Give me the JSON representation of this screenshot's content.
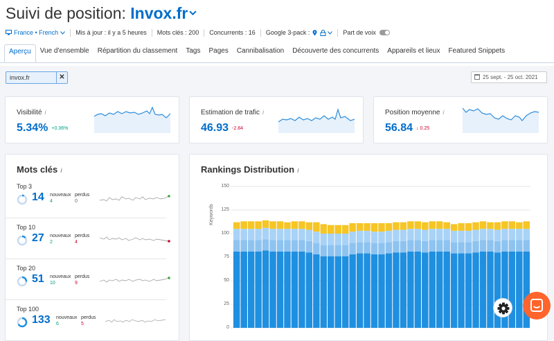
{
  "header": {
    "title_prefix": "Suivi de position: ",
    "project": "Invox.fr"
  },
  "meta": {
    "location": "France • French",
    "updated": "Mis à jour : il y a 5 heures",
    "keywords": "Mots clés : 200",
    "competitors": "Concurrents : 16",
    "google": "Google 3-pack :",
    "share_of_voice": "Part de voix"
  },
  "tabs": [
    "Aperçu",
    "Vue d'ensemble",
    "Répartition du classement",
    "Tags",
    "Pages",
    "Cannibalisation",
    "Découverte des concurrents",
    "Appareils et lieux",
    "Featured Snippets"
  ],
  "filter": {
    "domain": "invox.fr",
    "clear": "✕"
  },
  "date_range": "25 sept. - 25 oct. 2021",
  "kpis": [
    {
      "label": "Visibilité",
      "value": "5.34%",
      "delta": "+0.36%",
      "trend": "up"
    },
    {
      "label": "Estimation de trafic",
      "value": "46.93",
      "delta": "-2.84",
      "trend": "down"
    },
    {
      "label": "Position moyenne",
      "value": "56.84",
      "delta": "↓ 0.25",
      "trend": "down"
    }
  ],
  "info_glyph": "i",
  "keywords_card": {
    "title": "Mots clés",
    "new_label": "nouveaux",
    "lost_label": "perdus",
    "groups": [
      {
        "label": "Top 3",
        "value": "14",
        "new": "4",
        "lost": "0",
        "dot": "#3ca63c",
        "fill": 0.07
      },
      {
        "label": "Top 10",
        "value": "27",
        "new": "2",
        "lost": "4",
        "dot": "#d1002f",
        "fill": 0.14
      },
      {
        "label": "Top 20",
        "value": "51",
        "new": "10",
        "lost": "9",
        "dot": "#3ca63c",
        "fill": 0.26
      },
      {
        "label": "Top 100",
        "value": "133",
        "new": "6",
        "lost": "5",
        "dot": "#3ca63c",
        "fill": 0.67
      }
    ]
  },
  "rankings_card": {
    "title": "Rankings Distribution",
    "y_axis": "Keywords"
  },
  "colors": {
    "top3": "#f6c526",
    "top10": "#a9d3f6",
    "top20": "#8ec3f0",
    "top100": "#1f8fe0",
    "accent": "#006dca"
  },
  "chart_data": {
    "type": "bar",
    "stacked": true,
    "ylabel": "Keywords",
    "ylim": [
      0,
      150
    ],
    "yticks": [
      0,
      25,
      50,
      75,
      100,
      125,
      150
    ],
    "grid": true,
    "series": [
      {
        "values": [
          81,
          81,
          81,
          81,
          82,
          81,
          81,
          81,
          81,
          81,
          80,
          78,
          76,
          76,
          76,
          76,
          78,
          79,
          79,
          78,
          78,
          79,
          80,
          80,
          81,
          81,
          80,
          81,
          81,
          81,
          79,
          79,
          79,
          80,
          81,
          81,
          80,
          81,
          81,
          81,
          81
        ]
      },
      {
        "values": [
          12,
          12,
          12,
          12,
          12,
          12,
          12,
          12,
          12,
          12,
          12,
          12,
          12,
          12,
          12,
          12,
          12,
          12,
          12,
          12,
          12,
          12,
          12,
          12,
          12,
          12,
          12,
          12,
          12,
          12,
          12,
          12,
          12,
          12,
          12,
          12,
          12,
          12,
          12,
          12,
          12
        ]
      },
      {
        "values": [
          12,
          12,
          12,
          12,
          12,
          12,
          12,
          12,
          12,
          12,
          12,
          12,
          12,
          12,
          12,
          12,
          12,
          12,
          12,
          12,
          12,
          12,
          12,
          12,
          12,
          12,
          12,
          12,
          12,
          12,
          12,
          12,
          12,
          12,
          12,
          12,
          12,
          12,
          12,
          12,
          12
        ]
      },
      {
        "values": [
          7,
          8,
          8,
          8,
          8,
          8,
          8,
          7,
          8,
          8,
          8,
          10,
          10,
          9,
          9,
          9,
          9,
          8,
          8,
          9,
          9,
          8,
          8,
          8,
          8,
          8,
          8,
          8,
          8,
          7,
          7,
          8,
          8,
          8,
          8,
          7,
          8,
          8,
          8,
          7,
          8
        ]
      }
    ]
  }
}
